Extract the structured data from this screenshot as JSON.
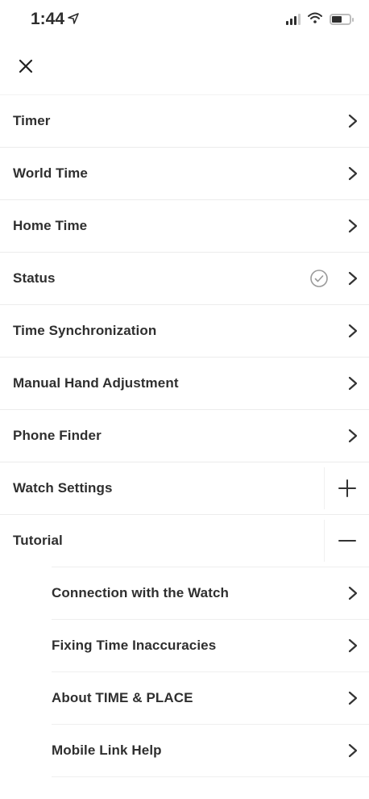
{
  "status_bar": {
    "time": "1:44",
    "location_arrow": "location-arrow-icon",
    "signal": "cellular-signal-icon",
    "wifi": "wifi-icon",
    "battery": "battery-icon"
  },
  "header": {
    "close_icon": "close-icon"
  },
  "menu": {
    "timer": "Timer",
    "world_time": "World Time",
    "home_time": "Home Time",
    "status": "Status",
    "time_sync": "Time Synchronization",
    "manual_hand": "Manual Hand Adjustment",
    "phone_finder": "Phone Finder",
    "watch_settings": "Watch Settings",
    "tutorial": "Tutorial"
  },
  "tutorial_items": {
    "connection": "Connection with the Watch",
    "fixing_time": "Fixing Time Inaccuracies",
    "about": "About TIME & PLACE",
    "mobile_link": "Mobile Link Help"
  },
  "colors": {
    "text": "#2f2f2f",
    "divider": "#ececec",
    "icon": "#333333",
    "check": "#9a9a9a"
  }
}
